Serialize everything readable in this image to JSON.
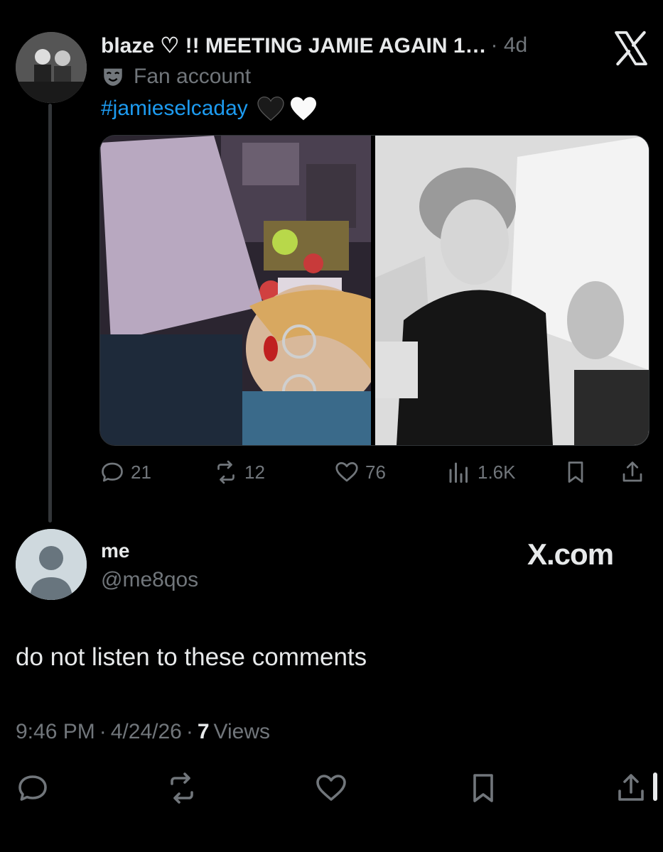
{
  "quoted_post": {
    "display_name": "blaze ♡ !! MEETING JAMIE AGAIN 1…",
    "time": "· 4d",
    "label": "Fan account",
    "hashtag": "#jamieselcaday",
    "stats": {
      "replies": "21",
      "reposts": "12",
      "likes": "76",
      "views": "1.6K"
    }
  },
  "reply": {
    "name": "me",
    "handle": "@me8qos",
    "watermark": "X.com",
    "text": "do not listen to these comments",
    "time": "9:46 PM",
    "date": "4/24/26",
    "views_count": "7",
    "views_label": "Views"
  },
  "colors": {
    "accent": "#1d9bf0",
    "muted": "#71767b",
    "text": "#e7e9ea",
    "background": "#000000"
  },
  "icons": [
    "x-logo-icon",
    "mask-icon",
    "black-heart-icon",
    "white-heart-icon",
    "reply-icon",
    "repost-icon",
    "like-icon",
    "views-icon",
    "bookmark-icon",
    "share-icon"
  ]
}
